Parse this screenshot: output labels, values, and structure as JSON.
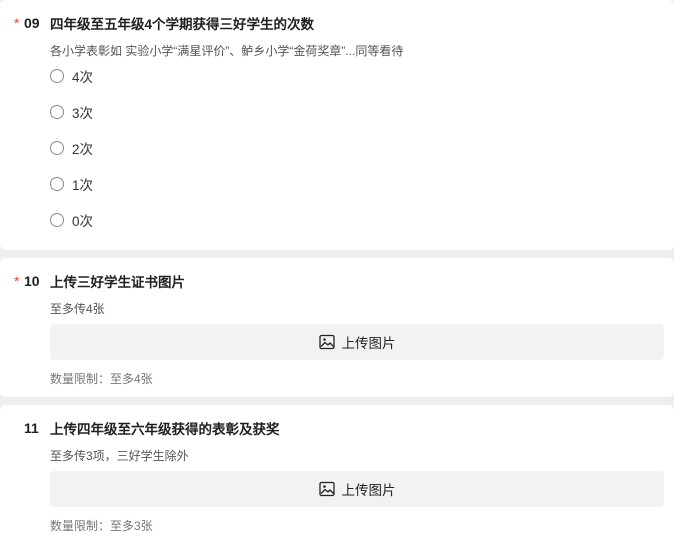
{
  "questions": [
    {
      "required": true,
      "number": "09",
      "title": "四年级至五年级4个学期获得三好学生的次数",
      "description": "各小学表彰如 实验小学“满星评价”、鲈乡小学“金荷奖章”...同等看待",
      "options": [
        "4次",
        "3次",
        "2次",
        "1次",
        "0次"
      ]
    },
    {
      "required": true,
      "number": "10",
      "title": "上传三好学生证书图片",
      "description": "至多传4张",
      "upload_label": "上传图片",
      "limit_text": "数量限制：至多4张"
    },
    {
      "required": false,
      "number": "11",
      "title": "上传四年级至六年级获得的表彰及获奖",
      "description": "至多传3项，三好学生除外",
      "upload_label": "上传图片",
      "limit_text": "数量限制：至多3张"
    }
  ],
  "required_mark": "*",
  "colors": {
    "required": "#e8473c",
    "upload_bg": "#f1f2f3",
    "page_bg": "#eeeeee"
  },
  "icons": {
    "option": "radio-circle",
    "upload": "image-icon"
  }
}
